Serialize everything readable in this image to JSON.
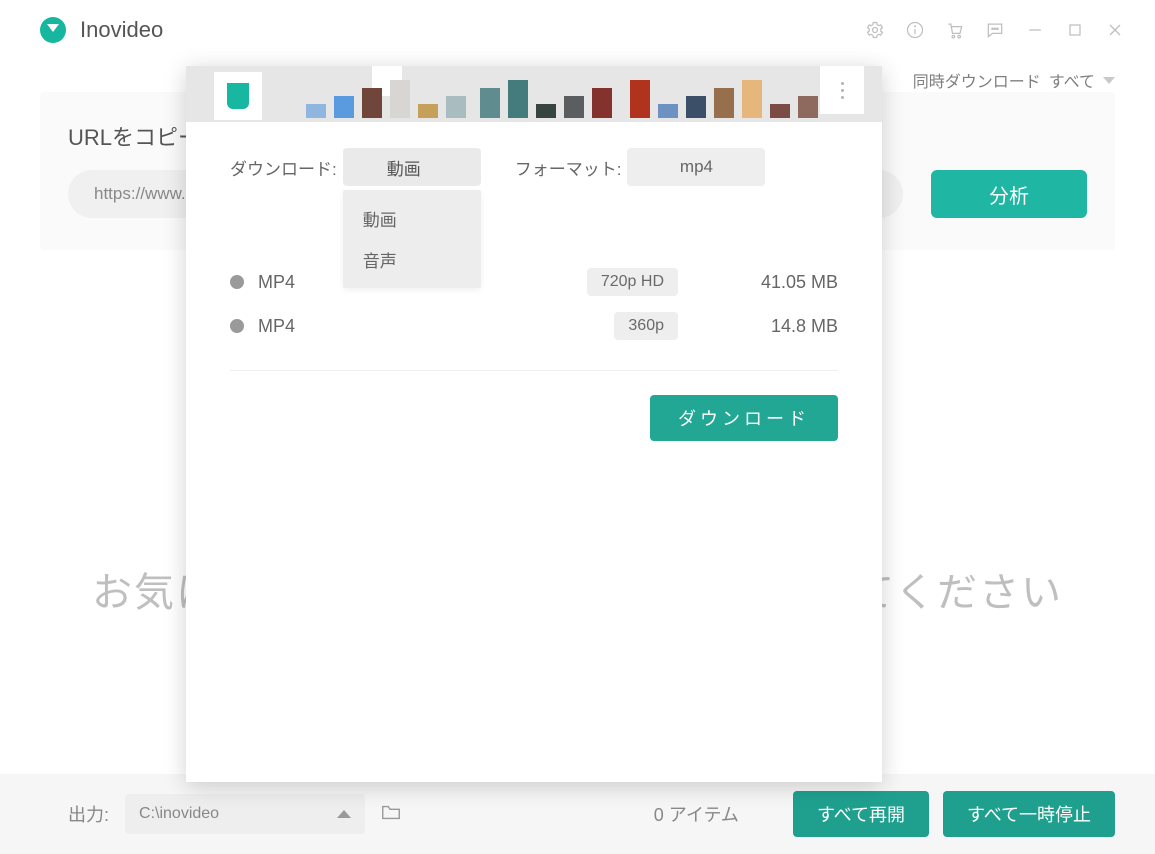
{
  "app": {
    "name": "Inovideo"
  },
  "toolbar": {
    "concurrent_label": "同時ダウンロード",
    "concurrent_value": "すべて"
  },
  "url_section": {
    "heading": "URLをコピー",
    "input_value": "https://www.",
    "analyze_label": "分析"
  },
  "dialog": {
    "download_type_label": "ダウンロード:",
    "download_type_value": "動画",
    "download_type_options": [
      "動画",
      "音声"
    ],
    "format_label": "フォーマット:",
    "format_value": "mp4",
    "rows": [
      {
        "codec": "MP4",
        "quality": "720p HD",
        "size": "41.05 MB"
      },
      {
        "codec": "MP4",
        "quality": "360p",
        "size": "14.8 MB"
      }
    ],
    "download_button": "ダウンロード"
  },
  "placeholder_text_left": "お気に",
  "placeholder_text_right": "てください",
  "bottom": {
    "output_label": "出力:",
    "output_path": "C:\\inovideo",
    "item_count": "0 アイテム",
    "resume_all": "すべて再開",
    "pause_all": "すべて一時停止"
  },
  "thumb_colors": [
    "#8fb6de",
    "#5a9be0",
    "#70463a",
    "#d8d6d2",
    "#c4a05a",
    "#a9bcc0",
    "#5e8c8f",
    "#447c7e",
    "#374541",
    "#5b5e60",
    "#83322e",
    "#b2331d",
    "#6d92c1",
    "#3c4f68",
    "#986f4c",
    "#e6b77c",
    "#7b4c43",
    "#8e6a5e"
  ]
}
